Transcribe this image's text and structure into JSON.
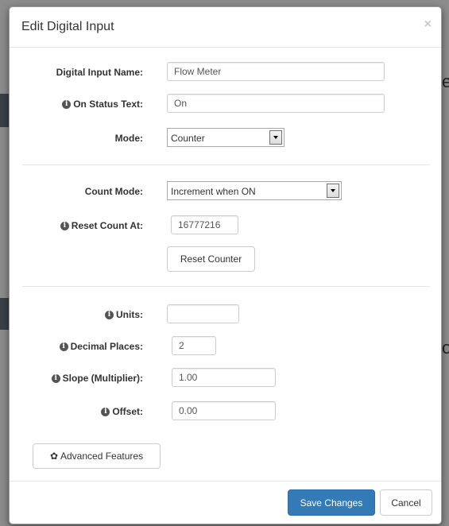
{
  "modal": {
    "title": "Edit Digital Input",
    "close_label": "×"
  },
  "background": {
    "fragments": [
      "e",
      "o"
    ]
  },
  "section1": {
    "name": {
      "label": "Digital Input Name:",
      "value": "Flow Meter"
    },
    "on_status": {
      "label": "On Status Text:",
      "value": "On",
      "icon": "info-icon"
    },
    "mode": {
      "label": "Mode:",
      "selected": "Counter"
    }
  },
  "section2": {
    "count_mode": {
      "label": "Count Mode:",
      "selected": "Increment when ON"
    },
    "reset_count": {
      "label": "Reset Count At:",
      "value": "16777216",
      "icon": "info-icon"
    },
    "reset_button": "Reset Counter"
  },
  "section3": {
    "units": {
      "label": "Units:",
      "value": "",
      "icon": "info-icon"
    },
    "decimal": {
      "label": "Decimal Places:",
      "value": "2",
      "icon": "info-icon"
    },
    "slope": {
      "label": "Slope (Multiplier):",
      "value": "1.00",
      "icon": "info-icon"
    },
    "offset": {
      "label": "Offset:",
      "value": "0.00",
      "icon": "info-icon"
    },
    "advanced_button": "Advanced Features",
    "advanced_icon": "cog-icon"
  },
  "footer": {
    "save_label": "Save Changes",
    "cancel_label": "Cancel"
  },
  "colors": {
    "primary": "#337ab7",
    "backdrop": "#8c8c8c"
  }
}
